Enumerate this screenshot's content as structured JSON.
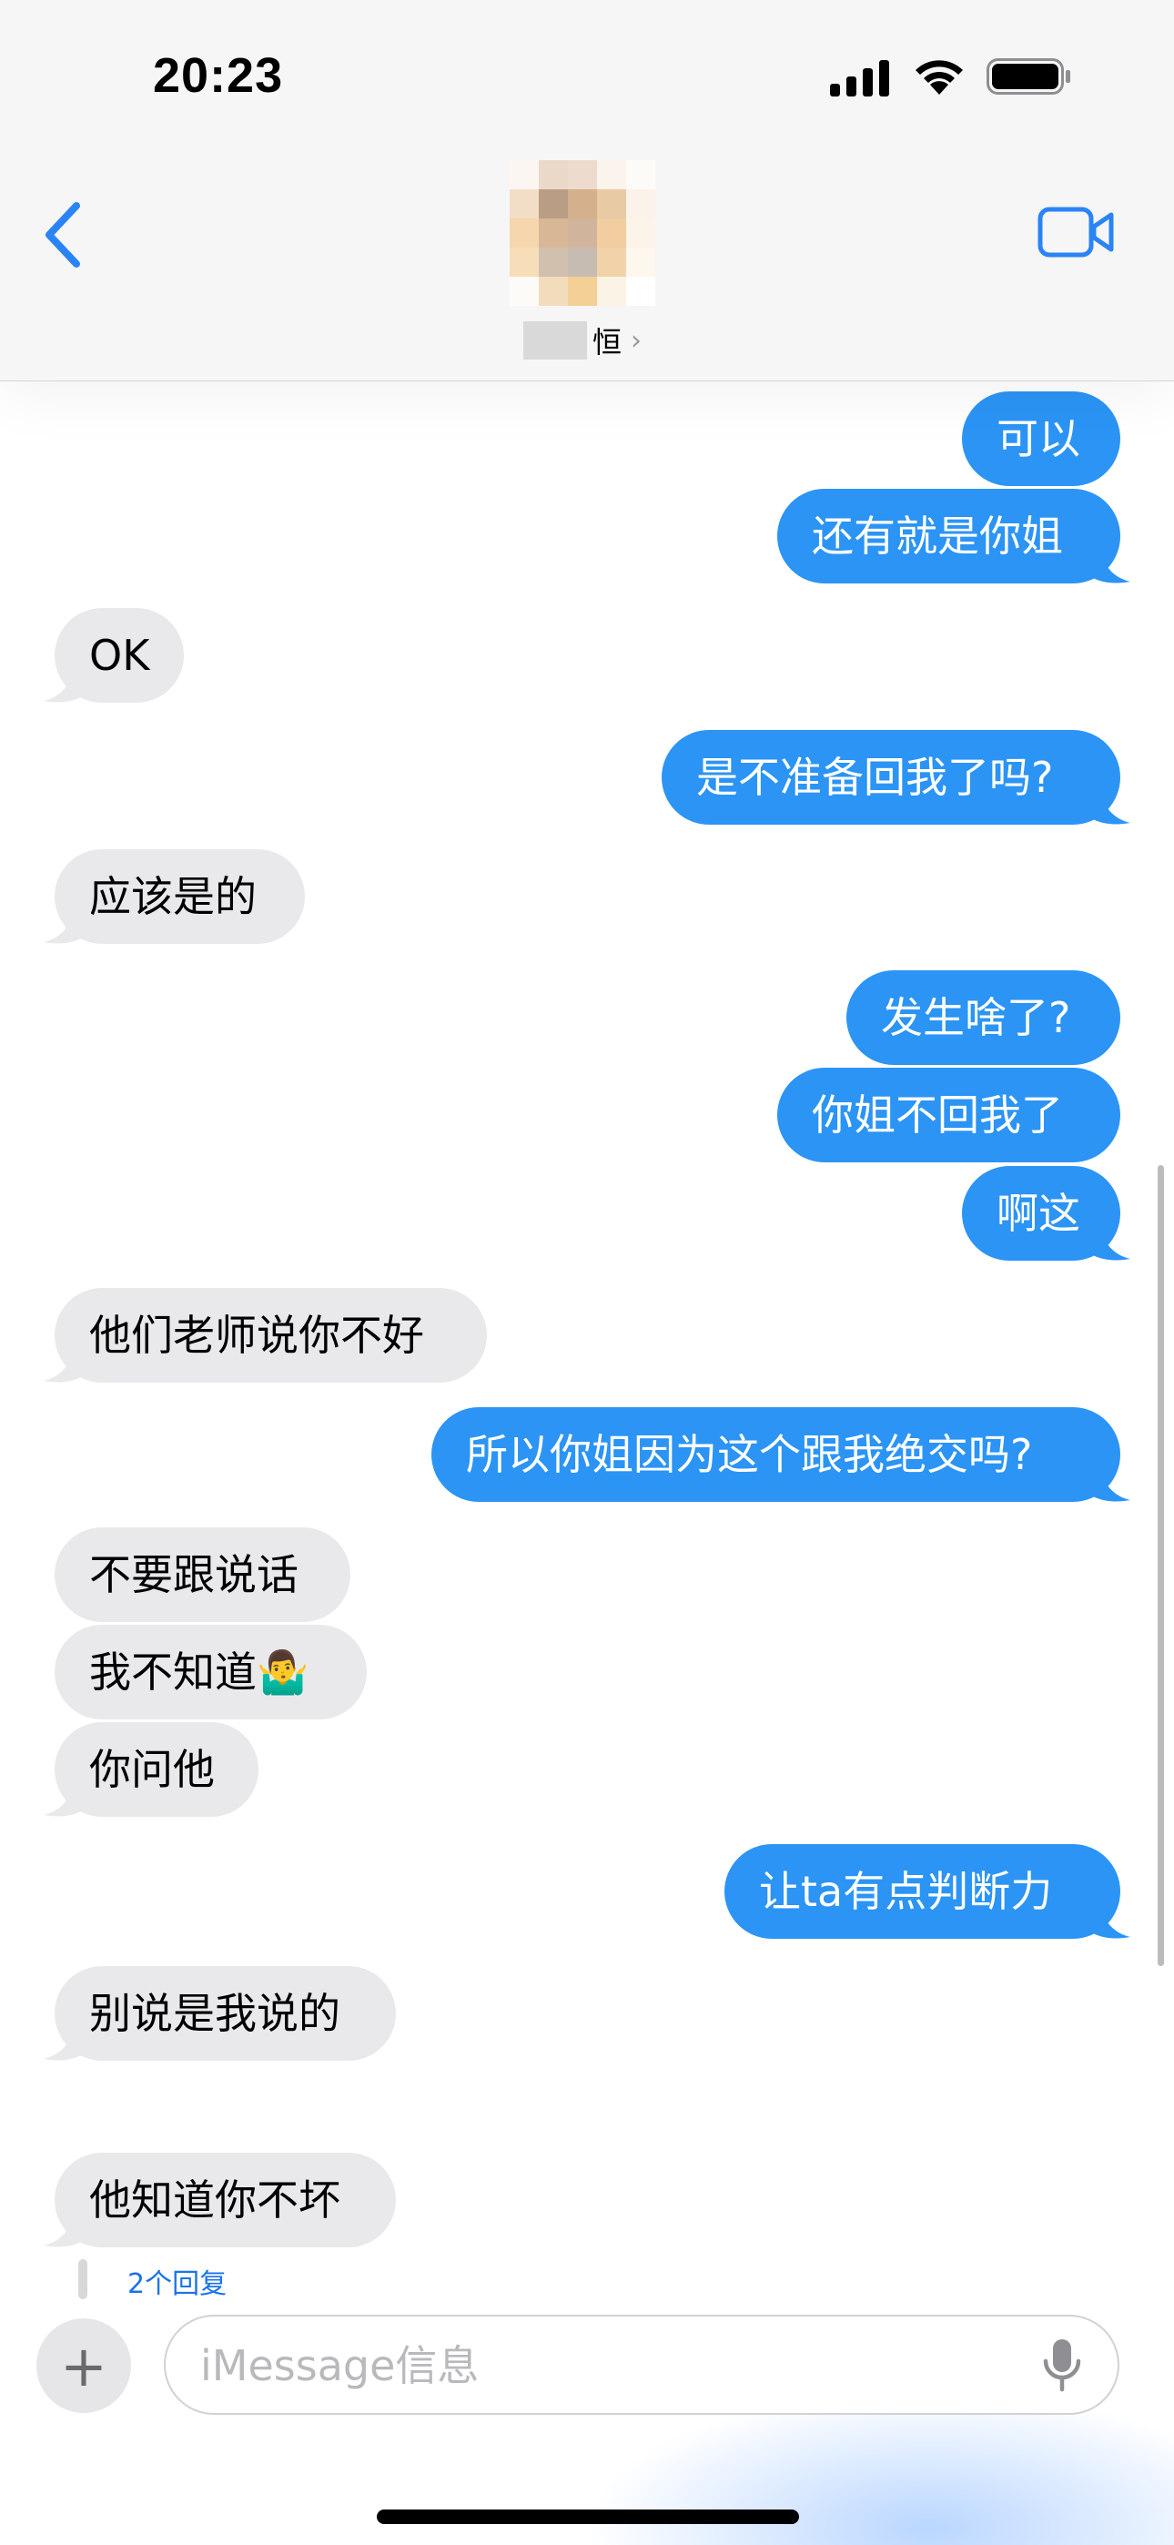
{
  "status_bar": {
    "time": "20:23"
  },
  "header": {
    "contact_name_suffix": "恒"
  },
  "messages": [
    {
      "type": "sent",
      "text": "可以"
    },
    {
      "type": "sent",
      "text": "还有就是你姐"
    },
    {
      "type": "received",
      "text": "OK"
    },
    {
      "type": "sent",
      "text": "是不准备回我了吗?"
    },
    {
      "type": "received",
      "text": "应该是的"
    },
    {
      "type": "sent",
      "text": "发生啥了?"
    },
    {
      "type": "sent",
      "text": "你姐不回我了"
    },
    {
      "type": "sent",
      "text": "啊这"
    },
    {
      "type": "received",
      "text": "他们老师说你不好"
    },
    {
      "type": "sent",
      "text": "所以你姐因为这个跟我绝交吗?"
    },
    {
      "type": "received",
      "text": "不要跟说话"
    },
    {
      "type": "received",
      "text": "我不知道🤷‍♂️"
    },
    {
      "type": "received",
      "text": "你问他"
    },
    {
      "type": "sent",
      "text": "让ta有点判断力"
    },
    {
      "type": "received",
      "text": "别说是我说的"
    },
    {
      "type": "received",
      "text": "他知道你不坏"
    }
  ],
  "thread": {
    "replies_label": "2个回复"
  },
  "composer": {
    "placeholder": "iMessage信息"
  },
  "colors": {
    "sent_bubble": "#2b94f5",
    "received_bubble": "#e9e9eb",
    "accent": "#2b84f5"
  }
}
